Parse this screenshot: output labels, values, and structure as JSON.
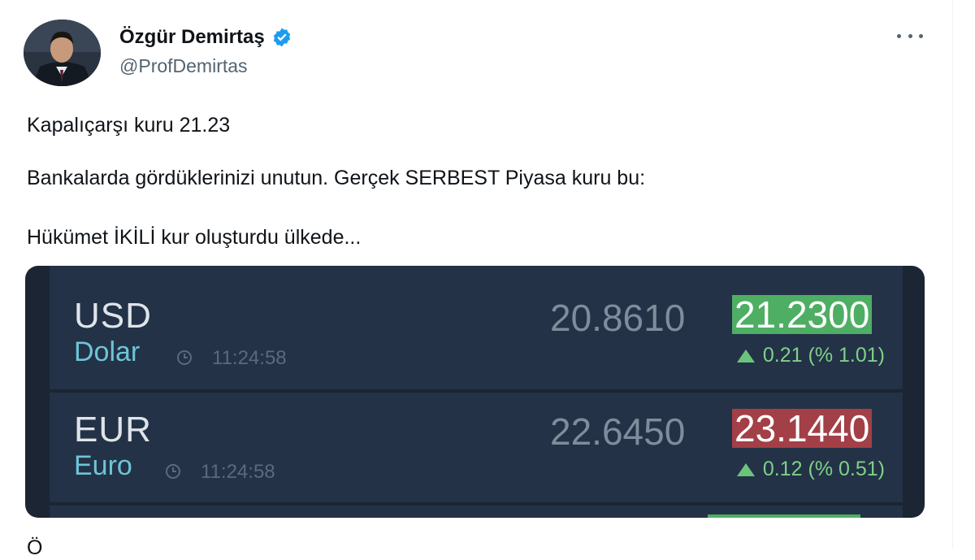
{
  "author": {
    "display_name": "Özgür Demirtaş",
    "handle": "@ProfDemirtas",
    "verified_icon": "verified-badge-icon",
    "avatar_icon": "avatar"
  },
  "tweet": {
    "lines": [
      "Kapalıçarşı kuru 21.23",
      "Bankalarda gördüklerinizi unutun. Gerçek SERBEST Piyasa kuru bu:",
      "Hükümet İKİLİ kur oluşturdu ülkede..."
    ],
    "truncated_next_line": "Ö"
  },
  "rates": [
    {
      "code": "USD",
      "name": "Dolar",
      "time": "11:24:58",
      "buy": "20.8610",
      "sell": "21.2300",
      "sell_color": "#4eae63",
      "change": "0.21 (% 1.01)",
      "direction": "up"
    },
    {
      "code": "EUR",
      "name": "Euro",
      "time": "11:24:58",
      "buy": "22.6450",
      "sell": "23.1440",
      "sell_color": "#a33f46",
      "change": "0.12 (% 0.51)",
      "direction": "up"
    }
  ],
  "colors": {
    "panel_bg": "#233246",
    "currency_name": "#6ec4d8",
    "change_up": "#7ed188",
    "verified": "#1d9bf0"
  }
}
